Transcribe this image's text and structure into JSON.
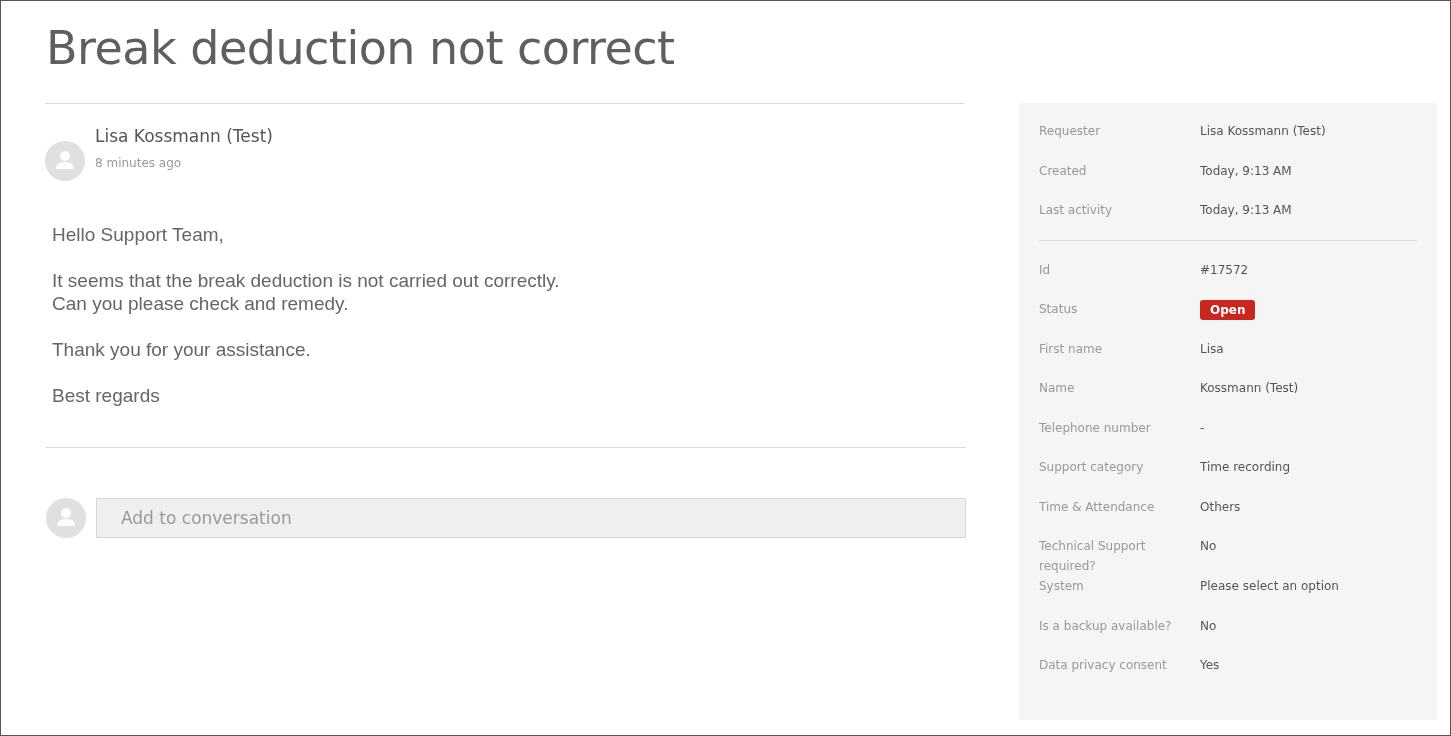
{
  "title": "Break deduction not correct",
  "message": {
    "author": "Lisa Kossmann (Test)",
    "time": "8 minutes ago",
    "paragraphs": [
      "Hello Support Team,",
      "It seems that the break deduction is not carried out correctly.\nCan you please check and remedy.",
      "Thank you for your assistance.",
      "Best regards"
    ]
  },
  "reply": {
    "placeholder": "Add to conversation"
  },
  "sidebar": {
    "summary": [
      {
        "label": "Requester",
        "value": "Lisa Kossmann (Test)",
        "kind": "text"
      },
      {
        "label": "Created",
        "value": "Today, 9:13 AM",
        "kind": "text"
      },
      {
        "label": "Last activity",
        "value": "Today, 9:13 AM",
        "kind": "text"
      }
    ],
    "attributes": [
      {
        "label": "Id",
        "value": "#17572",
        "kind": "text"
      },
      {
        "label": "Status",
        "value": "Open",
        "kind": "badge",
        "color": "#c8261e"
      },
      {
        "label": "First name",
        "value": "Lisa",
        "kind": "text"
      },
      {
        "label": "Name",
        "value": "Kossmann (Test)",
        "kind": "text"
      },
      {
        "label": "Telephone number",
        "value": "-",
        "kind": "text"
      },
      {
        "label": "Support category",
        "value": "Time recording",
        "kind": "text"
      },
      {
        "label": "Time & Attendance",
        "value": "Others",
        "kind": "text"
      },
      {
        "label": "Technical Support required?",
        "value": "No",
        "kind": "text"
      },
      {
        "label": "System",
        "value": "Please select an option",
        "kind": "text"
      },
      {
        "label": "Is a backup available?",
        "value": "No",
        "kind": "text"
      },
      {
        "label": "Data privacy consent",
        "value": "Yes",
        "kind": "text"
      }
    ]
  }
}
